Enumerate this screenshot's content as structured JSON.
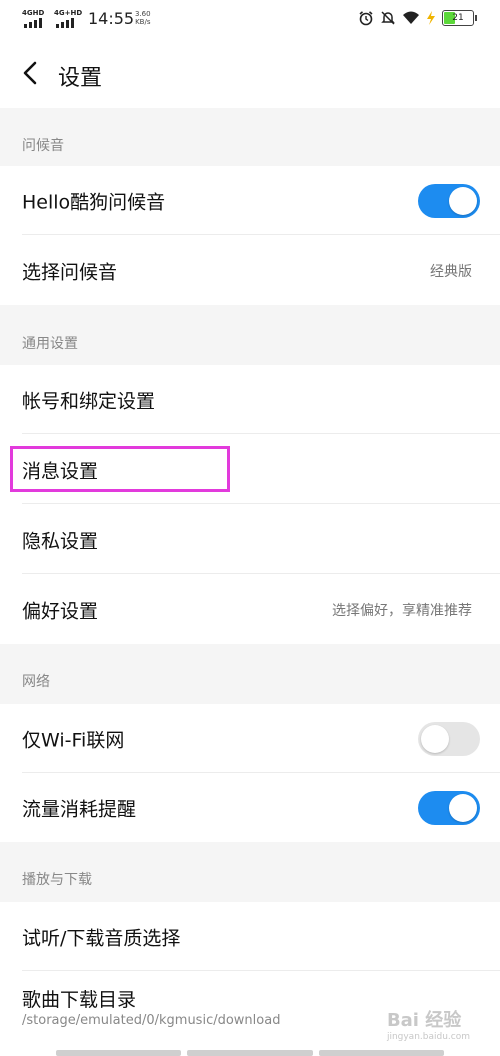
{
  "status_bar": {
    "signal1": "4GHD",
    "signal2": "4G+HD",
    "time": "14:55",
    "speed_value": "3.60",
    "speed_unit": "KB/s",
    "battery": "21"
  },
  "header": {
    "title": "设置"
  },
  "sections": {
    "greeting": {
      "label": "问候音",
      "hello_label": "Hello酷狗问候音",
      "hello_on": true,
      "choose_label": "选择问候音",
      "choose_value": "经典版"
    },
    "general": {
      "label": "通用设置",
      "account_label": "帐号和绑定设置",
      "message_label": "消息设置",
      "privacy_label": "隐私设置",
      "pref_label": "偏好设置",
      "pref_value": "选择偏好，享精准推荐"
    },
    "network": {
      "label": "网络",
      "wifi_label": "仅Wi-Fi联网",
      "wifi_on": false,
      "traffic_label": "流量消耗提醒",
      "traffic_on": true
    },
    "playback": {
      "label": "播放与下载",
      "quality_label": "试听/下载音质选择",
      "dir_label": "歌曲下载目录",
      "dir_value": "/storage/emulated/0/kgmusic/download"
    }
  },
  "watermark": {
    "brand": "Bai 经验",
    "url": "jingyan.baidu.com"
  }
}
